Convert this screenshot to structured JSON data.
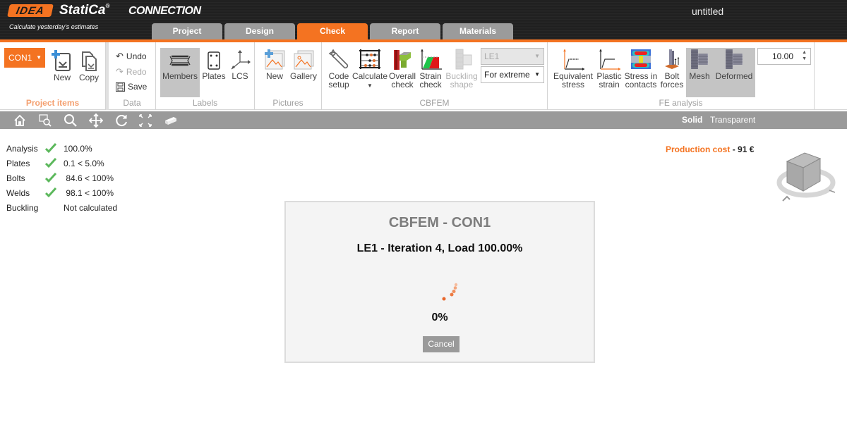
{
  "app": {
    "brand": "IDEA",
    "product": "StatiCa",
    "registered": "®",
    "module": "CONNECTION",
    "tagline": "Calculate yesterday's estimates",
    "document_title": "untitled"
  },
  "tabs": [
    {
      "label": "Project",
      "active": false
    },
    {
      "label": "Design",
      "active": false
    },
    {
      "label": "Check",
      "active": true
    },
    {
      "label": "Report",
      "active": false
    },
    {
      "label": "Materials",
      "active": false
    }
  ],
  "ribbon": {
    "project_items": {
      "label": "Project items",
      "connection_select": "CON1",
      "new": "New",
      "copy": "Copy"
    },
    "data": {
      "label": "Data",
      "undo": "Undo",
      "redo": "Redo",
      "save": "Save"
    },
    "labels": {
      "label": "Labels",
      "members": "Members",
      "plates": "Plates",
      "lcs": "LCS"
    },
    "pictures": {
      "label": "Pictures",
      "new": "New",
      "gallery": "Gallery"
    },
    "cbfem": {
      "label": "CBFEM",
      "code_setup_1": "Code",
      "code_setup_2": "setup",
      "calculate": "Calculate",
      "overall_1": "Overall",
      "overall_2": "check",
      "strain_1": "Strain",
      "strain_2": "check",
      "buckling_1": "Buckling",
      "buckling_2": "shape",
      "load_effect": "LE1",
      "extreme_mode": "For extreme"
    },
    "fe_analysis": {
      "label": "FE analysis",
      "equiv_1": "Equivalent",
      "equiv_2": "stress",
      "plastic_1": "Plastic",
      "plastic_2": "strain",
      "contacts_1": "Stress in",
      "contacts_2": "contacts",
      "bolt_1": "Bolt",
      "bolt_2": "forces",
      "mesh": "Mesh",
      "deformed": "Deformed",
      "scale_value": "10.00"
    }
  },
  "view_toolbar": {
    "solid": "Solid",
    "transparent": "Transparent"
  },
  "results": [
    {
      "label": "Analysis",
      "ok": true,
      "value": "100.0%"
    },
    {
      "label": "Plates",
      "ok": true,
      "value": "0.1 < 5.0%"
    },
    {
      "label": "Bolts",
      "ok": true,
      "value": " 84.6 < 100%"
    },
    {
      "label": "Welds",
      "ok": true,
      "value": " 98.1 < 100%"
    },
    {
      "label": "Buckling",
      "ok": false,
      "value": "Not calculated"
    }
  ],
  "production_cost": {
    "label": "Production cost",
    "separator": "-",
    "value": "91 €"
  },
  "dialog": {
    "title": "CBFEM - CON1",
    "status": "LE1 - Iteration  4, Load  100.00%",
    "progress": "0%",
    "cancel": "Cancel"
  },
  "colors": {
    "accent": "#f47321",
    "tab_inactive": "#9b9b9b",
    "toolbar": "#9a9a9a",
    "check_ok": "#5cb85c"
  }
}
